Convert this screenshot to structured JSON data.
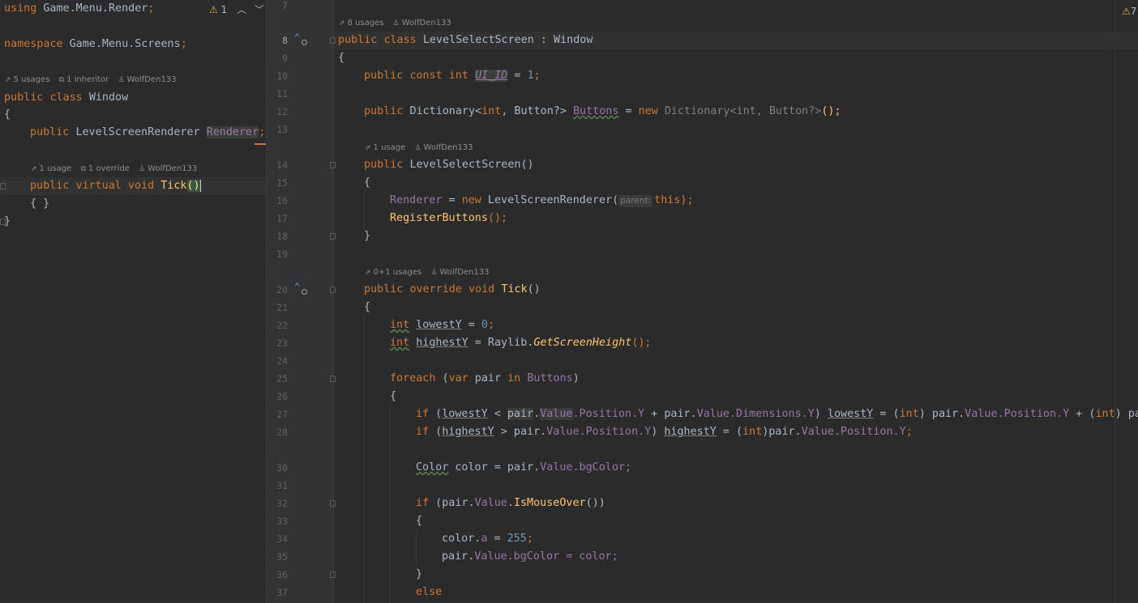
{
  "left_editor": {
    "warnings": {
      "count": "1"
    },
    "nav": {
      "up": "⌃",
      "down": "⌄"
    },
    "lines": {
      "l1": {
        "kw": "using",
        "ns": "Game.Menu.Render",
        "semi": ";"
      },
      "l2": {
        "kw": "namespace",
        "ns": "Game.Menu.Screens",
        "semi": ";"
      },
      "l3": {
        "kw1": "public",
        "kw2": "class",
        "name": "Window"
      },
      "l4": {
        "brace": "{"
      },
      "l5": {
        "kw": "public",
        "type": "LevelScreenRenderer",
        "field": "Renderer",
        "semi": ";"
      },
      "l6": {
        "kw1": "public",
        "kw2": "virtual",
        "kw3": "void",
        "name": "Tick",
        "parens": "()"
      },
      "l7": {
        "body": "{ }"
      },
      "l8": {
        "brace": "}"
      }
    },
    "hints": {
      "class": {
        "usages": "5 usages",
        "inheritors": "1 inheritor",
        "author": "WolfDen133"
      },
      "tick": {
        "usages": "1 usage",
        "overrides": "1 override",
        "author": "WolfDen133"
      }
    }
  },
  "right_editor": {
    "warnings": {
      "count": "7"
    },
    "line_numbers": [
      "7",
      "8",
      "9",
      "10",
      "11",
      "12",
      "13",
      "14",
      "15",
      "16",
      "17",
      "18",
      "19",
      "20",
      "21",
      "22",
      "23",
      "24",
      "25",
      "26",
      "27",
      "28",
      "30",
      "31",
      "32",
      "33",
      "34",
      "35",
      "36",
      "37"
    ],
    "hints": {
      "class": {
        "usages": "8 usages",
        "author": "WolfDen133"
      },
      "ctor": {
        "usages": "1 usage",
        "author": "WolfDen133"
      },
      "tick": {
        "usages": "0+1 usages",
        "author": "WolfDen133"
      }
    },
    "code": {
      "l8": {
        "a": "public",
        "b": "class",
        "c": "LevelSelectScreen : Window"
      },
      "l9": {
        "a": "{"
      },
      "l10": {
        "a": "public",
        "b": "const",
        "c": "int",
        "d": "UI_ID",
        "e": " = ",
        "f": "1",
        "g": ";"
      },
      "l12": {
        "a": "public",
        "b": "Dictionary<",
        "c": "int",
        "d": ", Button?> ",
        "e": "Buttons",
        "f": " = ",
        "g": "new",
        "h": " Dictionary<int, Button?>",
        "i": "();"
      },
      "l14": {
        "a": "public",
        "b": "LevelSelectScreen",
        "c": "()"
      },
      "l15": {
        "a": "{"
      },
      "l16": {
        "a": "Renderer",
        "b": " = ",
        "c": "new",
        "d": " LevelScreenRenderer(",
        "p": "parent:",
        "e": "this",
        "f": ");"
      },
      "l17": {
        "a": "RegisterButtons",
        "b": "();"
      },
      "l18": {
        "a": "}"
      },
      "l20": {
        "a": "public",
        "b": "override",
        "c": "void",
        "d": "Tick",
        "e": "()"
      },
      "l21": {
        "a": "{"
      },
      "l22": {
        "a": "int",
        "b": "lowestY",
        "c": " = ",
        "d": "0",
        "e": ";"
      },
      "l23": {
        "a": "int",
        "b": "highestY",
        "c": " = Raylib.",
        "d": "GetScreenHeight",
        "e": "();"
      },
      "l25": {
        "a": "foreach",
        "b": " (",
        "c": "var",
        "d": " pair ",
        "e": "in",
        "f": " ",
        "g": "Buttons",
        "h": ")"
      },
      "l26": {
        "a": "{"
      },
      "l27": {
        "a": "if",
        "b": " (",
        "c": "lowestY",
        "d": " < ",
        "e": "pair",
        "f": ".",
        "g": "Value",
        "h": ".Position.",
        "i": "Y",
        "j": " + pair.",
        "k": "Value",
        "l": ".Dimensions.",
        "m": "Y",
        "n": ") ",
        "o": "lowestY",
        "q": " = (",
        "r": "int",
        "s": ") pair.",
        "t": "Value",
        "u": ".Position.",
        "v": "Y",
        "w": " + (",
        "x": "int",
        "y": ") pai"
      },
      "l28": {
        "a": "if",
        "b": " (",
        "c": "highestY",
        "d": " > pair.",
        "e": "Value",
        "f": ".Position.",
        "g": "Y",
        "h": ") ",
        "i": "highestY",
        "j": " = (",
        "k": "int",
        "l": ")pair.",
        "m": "Value",
        "n": ".Position.",
        "o": "Y",
        "p": ";"
      },
      "l30": {
        "a": "Color",
        "b": " color = pair.",
        "c": "Value",
        "d": ".bgColor;"
      },
      "l32": {
        "a": "if",
        "b": " (pair.",
        "c": "Value",
        "d": ".",
        "e": "IsMouseOver",
        "f": "())"
      },
      "l33": {
        "a": "{"
      },
      "l34": {
        "a": "color.",
        "b": "a",
        "c": " = ",
        "d": "255",
        "e": ";"
      },
      "l35": {
        "a": "pair.",
        "b": "Value",
        "c": ".bgColor = color;"
      },
      "l36": {
        "a": "}"
      },
      "l37": {
        "a": "else"
      }
    }
  },
  "colors": {
    "background": "#2b2b2b",
    "keyword": "#cc7832",
    "method": "#ffc66d",
    "field": "#9876aa",
    "number": "#6897bb",
    "warning": "#e0b050"
  }
}
